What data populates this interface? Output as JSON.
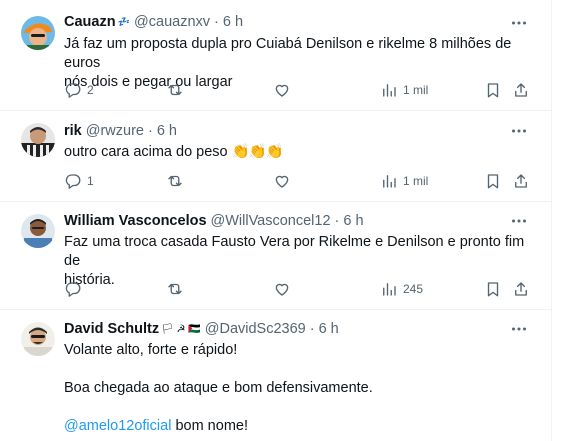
{
  "tweets": [
    {
      "name": "Cauazn",
      "name_emoji": "💤",
      "handle": "@cauaznxv",
      "time": "6 h",
      "lines": [
        "Já faz um proposta dupla pro Cuiabá Denilson e rikelme 8 milhões de euros",
        "nós dois e pegar ou largar"
      ],
      "reply_count": "2",
      "views": "1 mil"
    },
    {
      "name": "rik",
      "handle": "@rwzure",
      "time": "6 h",
      "text": "outro cara acima do peso",
      "text_emoji": "👏👏👏",
      "reply_count": "1",
      "views": "1 mil"
    },
    {
      "name": "William Vasconcelos",
      "handle": "@WillVasconcel12",
      "time": "6 h",
      "lines": [
        "Faz uma troca casada Fausto Vera por Rikelme e Denilson e pronto fim de",
        "história."
      ],
      "views": "245"
    },
    {
      "name": "David Schultz",
      "name_emoji": "🏳 ☭ 🇵🇸",
      "handle": "@DavidSc2369",
      "time": "6 h",
      "line1": "Volante alto, forte e rápido!",
      "line2": "Boa chegada ao ataque e bom defensivamente.",
      "mention": "@amelo12oficial",
      "line3_rest": " bom nome!"
    }
  ],
  "separator": "·",
  "colors": {
    "text": "#0f1419",
    "secondary": "#536471",
    "link": "#1d9bf0",
    "border": "#eff3f4"
  },
  "icons": [
    "more-icon",
    "reply-icon",
    "repost-icon",
    "like-icon",
    "views-icon",
    "bookmark-icon",
    "share-icon"
  ]
}
